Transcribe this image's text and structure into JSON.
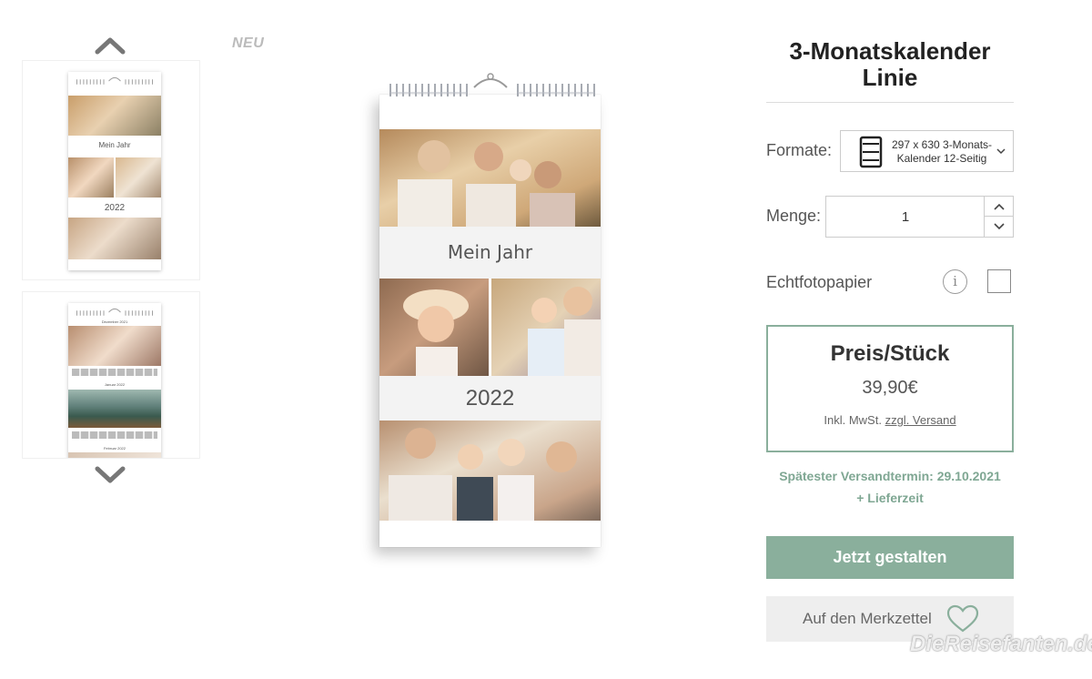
{
  "badge": "NEU",
  "thumbnails": [
    {
      "label_mid": "Mein Jahr",
      "label_bottom": "2022"
    },
    {
      "label_top": "Dezember 2021",
      "label_mid": "Januar 2022",
      "label_bottom": "Februar 2022"
    }
  ],
  "calendar": {
    "title_text": "Mein Jahr",
    "year": "2022"
  },
  "product": {
    "title": "3-Monatskalender Linie",
    "format_label": "Formate:",
    "format_value": "297 x 630 3-Monats-Kalender 12-Seitig",
    "quantity_label": "Menge:",
    "quantity_value": "1",
    "photo_paper_label": "Echtfotopapier",
    "info_glyph": "i"
  },
  "price": {
    "title": "Preis/Stück",
    "value": "39,90€",
    "tax_text": "Inkl. MwSt.",
    "shipping_link": "zzgl. Versand"
  },
  "shipping": {
    "line1": "Spätester Versandtermin: 29.10.2021",
    "line2": "+ Lieferzeit"
  },
  "buttons": {
    "design": "Jetzt gestalten",
    "wishlist": "Auf den Merkzettel"
  },
  "watermark": "DieReisefanten.de",
  "colors": {
    "accent": "#8aaf9c",
    "accent_text": "#7fa793"
  }
}
